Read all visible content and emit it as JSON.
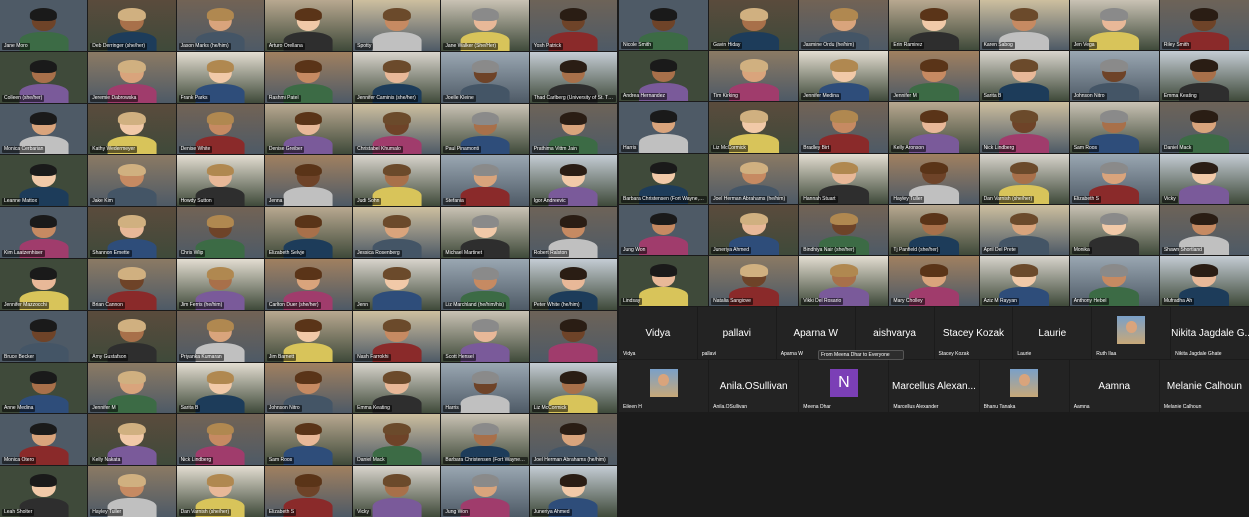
{
  "left_grid": [
    "Jane Moro",
    "Deb Derringer (she/her)",
    "Jason Marks (he/him)",
    "Arturo Orellana",
    "Spotty",
    "Jane Walker (She/Her)",
    "Yosh Patrick",
    "Colleen (she/her)",
    "Jeremie Dabrowska",
    "Frank Parks",
    "Rashmi Patel",
    "Jennifer Caminis (she/her)",
    "Joelle Kleine",
    "Thad Carlberg (University of St. Thomas) (he/...",
    "Monica Cerbarian",
    "Kathy Wedermeyer",
    "Denise White",
    "Denise Greiber",
    "Christabel Khumalo",
    "Paul Pinamonti",
    "Prathima Vittm Jain",
    "Leanne Mattox",
    "Jake Kim",
    "Howdy Sutton",
    "Jenna",
    "Judi Sohn",
    "Stefania",
    "Igor Andreevic",
    "Kim Laatzenhiser",
    "Shannon Emette",
    "Chris Wlip",
    "Elizabeth Selvje",
    "Jessica Rosenberg",
    "Michael Martinet",
    "Robert Ralston",
    "Jennifer Mazzocchi",
    "Brian Cannon",
    "Jim Ferris (he/him)",
    "Carlton Duer (she/her)",
    "Jenn",
    "Liz Marchland (he/him/his)",
    "Peter White (he/him)",
    "Bruce Becker",
    "Amy Gustafson",
    "Priyanka Kumaran",
    "Jim Barnett",
    "Nash Farrokhi",
    "Scott Hensel",
    "",
    "Anne Medina",
    "Jennifer M",
    "Sarita B",
    "Johnson Nitro",
    "Emma Keating",
    "Harris",
    "Liz McCormick",
    "Monica Otero",
    "Kelly Nakata",
    "Nick Lindberg",
    "Sam Roos",
    "Daniel Mack",
    "Barbara Christensen (Fort Wayne, IN, she/her)",
    "Joel Herman Abrahams (he/him)",
    "Leah Sholter",
    "Hayley Tuller",
    "Dan Varnish (she/her)",
    "Elizabeth S",
    "Vicky",
    "Jung Won",
    "Juneriya Ahmed"
  ],
  "right_grid": [
    "Nicole Smith",
    "Gavin Hiday",
    "Jasmine Ordu (he/him)",
    "Erin Ramirez",
    "Karen Sabog",
    "Jen Vega",
    "Riley Smith",
    "Andrea Hernandez",
    "Tim Kirking",
    "Jennifer Medina",
    "Jennifer M",
    "Sarita B",
    "Johnson Nitro",
    "Emma Keating",
    "Harris",
    "Liz McCormick",
    "Bradley Birt",
    "Kelly Aronson",
    "Nick Lindberg",
    "Sam Roos",
    "Daniel Mack",
    "Barbara Christensen (Fort Wayne, IN, she/her)",
    "Joel Herman Abrahams (he/him)",
    "Hannah Stuart",
    "Hayley Tuller",
    "Dan Varnish (she/her)",
    "Elizabeth S",
    "Vicky",
    "Jung Won",
    "Juneriya Ahmed",
    "Bindhiya Nair (she/her)",
    "Tj Panfield (she/her)",
    "April Del Prete",
    "Monika",
    "Shawn Shortland",
    "Lindsay",
    "Natalia Sangiove",
    "Vikki Del Rosario",
    "Mary Cholley",
    "Aziz M Rayyan",
    "Anthony Hebel",
    "Mufradha Ah"
  ],
  "video_off": {
    "row1": [
      {
        "display": "Vidya",
        "label": "Vidya"
      },
      {
        "display": "pallavi",
        "label": "pallavi"
      },
      {
        "display": "Aparna W",
        "label": "Aparna W"
      },
      {
        "display": "aishvarya",
        "label": "aishvarya"
      },
      {
        "display": "Stacey Kozak",
        "label": "Stacey Kozak"
      },
      {
        "display": "Laurie",
        "label": "Laurie"
      },
      {
        "display": "",
        "label": "Ruth Ilaa"
      },
      {
        "display": "Nikita Jagdale G...",
        "label": "Nikita Jagdale Ghate"
      }
    ],
    "row2": [
      {
        "display": "",
        "label": "Eileen H"
      },
      {
        "display": "Anila.OSullivan",
        "label": "Anila.OSullivan"
      },
      {
        "display": "N",
        "label": "Meena Dhar"
      },
      {
        "display": "Marcellus Alexan...",
        "label": "Marcellus Alexander"
      },
      {
        "display": "",
        "label": "Bhanu Tanaka"
      },
      {
        "display": "Aamna",
        "label": "Aamna"
      },
      {
        "display": "Melanie Calhoun",
        "label": "Melanie Calhoun"
      }
    ]
  },
  "toast": "From Meena Dhar to Everyone"
}
